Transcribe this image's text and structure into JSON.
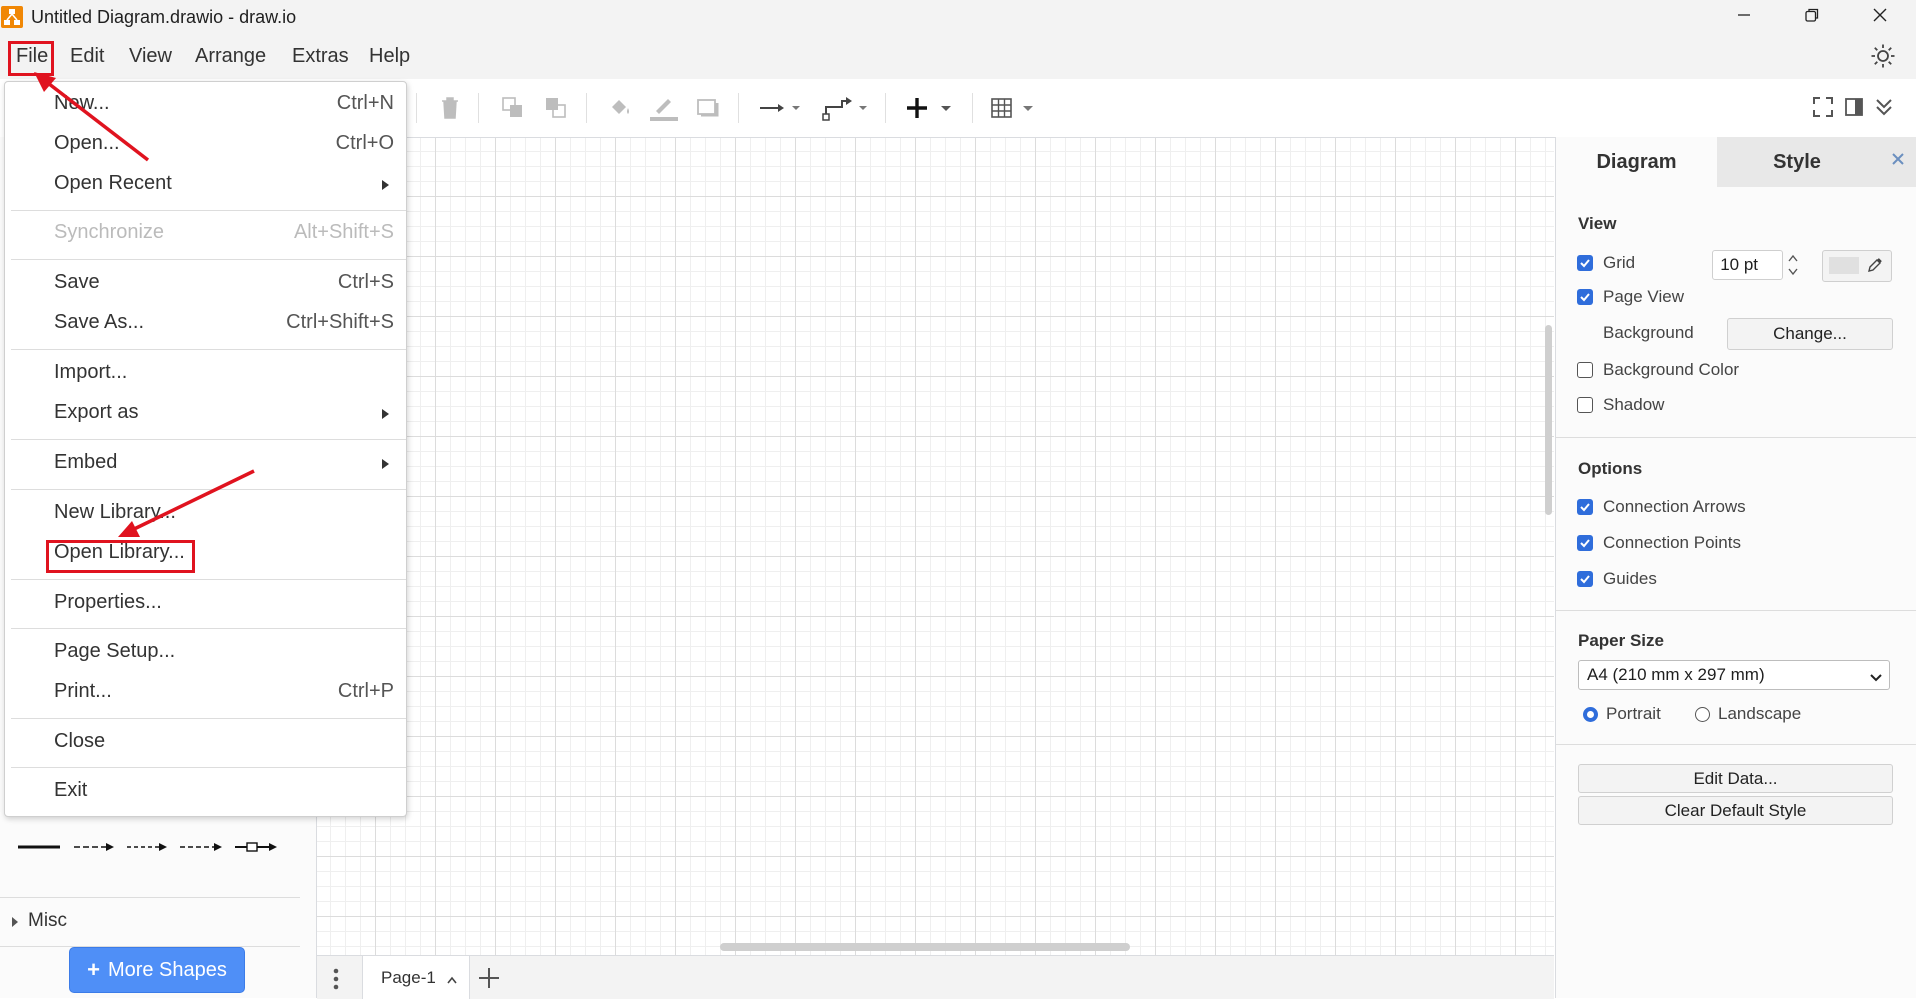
{
  "window": {
    "title": "Untitled Diagram.drawio - draw.io",
    "minimize_icon": "minimize-icon",
    "restore_icon": "restore-icon",
    "close_icon": "close-icon"
  },
  "menubar": {
    "items": [
      "File",
      "Edit",
      "View",
      "Arrange",
      "Extras",
      "Help"
    ],
    "theme_icon": "sun-icon"
  },
  "file_menu": {
    "items": [
      {
        "label": "New...",
        "shortcut": "Ctrl+N"
      },
      {
        "label": "Open...",
        "shortcut": "Ctrl+O"
      },
      {
        "label": "Open Recent",
        "submenu": true
      },
      {
        "label": "Synchronize",
        "shortcut": "Alt+Shift+S",
        "disabled": true
      },
      {
        "label": "Save",
        "shortcut": "Ctrl+S"
      },
      {
        "label": "Save As...",
        "shortcut": "Ctrl+Shift+S"
      },
      {
        "label": "Import..."
      },
      {
        "label": "Export as",
        "submenu": true
      },
      {
        "label": "Embed",
        "submenu": true
      },
      {
        "label": "New Library..."
      },
      {
        "label": "Open Library..."
      },
      {
        "label": "Properties..."
      },
      {
        "label": "Page Setup..."
      },
      {
        "label": "Print...",
        "shortcut": "Ctrl+P"
      },
      {
        "label": "Close"
      },
      {
        "label": "Exit"
      }
    ]
  },
  "left_panel": {
    "misc_label": "Misc",
    "more_shapes_label": "More Shapes"
  },
  "pagebar": {
    "page_tab": "Page-1"
  },
  "format_panel": {
    "tabs": [
      "Diagram",
      "Style"
    ],
    "view_title": "View",
    "grid_label": "Grid",
    "grid_checked": true,
    "grid_size": "10 pt",
    "page_view_label": "Page View",
    "page_view_checked": true,
    "background_label": "Background",
    "change_button": "Change...",
    "background_color_label": "Background Color",
    "background_color_checked": false,
    "shadow_label": "Shadow",
    "shadow_checked": false,
    "options_title": "Options",
    "connection_arrows_label": "Connection Arrows",
    "connection_points_label": "Connection Points",
    "guides_label": "Guides",
    "paper_size_title": "Paper Size",
    "paper_size_value": "A4 (210 mm x 297 mm)",
    "portrait_label": "Portrait",
    "landscape_label": "Landscape",
    "orientation": "Portrait",
    "edit_data_button": "Edit Data...",
    "clear_default_style_button": "Clear Default Style"
  },
  "colors": {
    "accent_blue": "#2f6ddb",
    "annotation_red": "#e0131f",
    "more_shapes_blue": "#4f8ff7",
    "logo_orange": "#f08705"
  }
}
